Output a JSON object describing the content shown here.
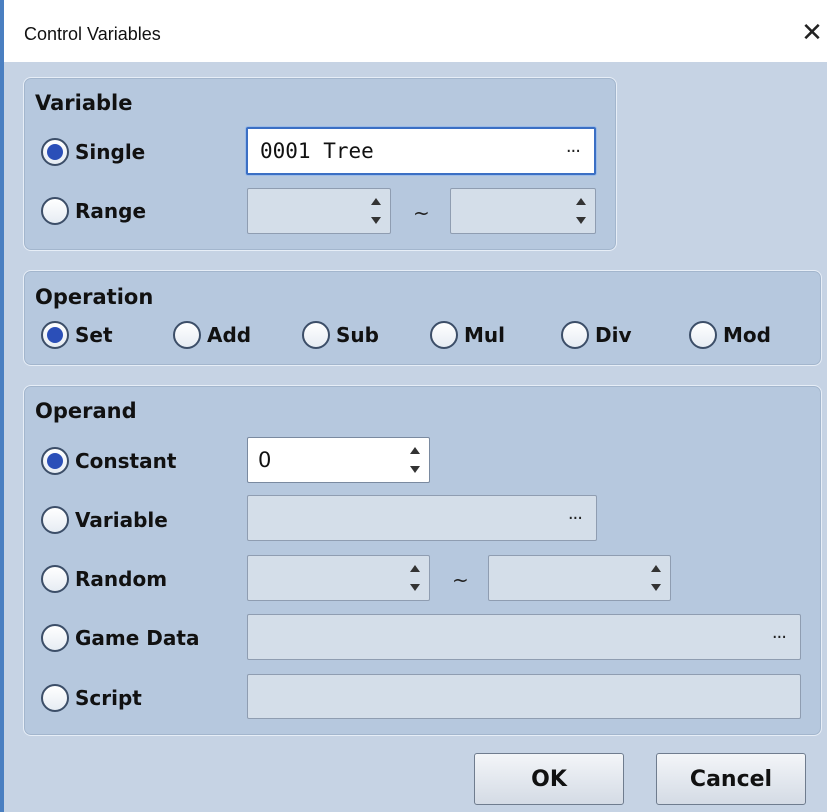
{
  "window": {
    "title": "Control Variables",
    "close_glyph": "✕"
  },
  "variable": {
    "title": "Variable",
    "single_label": "Single",
    "range_label": "Range",
    "single_value": "0001 Tree",
    "ellipsis": "···",
    "range_separator": "~",
    "range_from": "",
    "range_to": "",
    "mode": "single"
  },
  "operation": {
    "title": "Operation",
    "options": [
      "Set",
      "Add",
      "Sub",
      "Mul",
      "Div",
      "Mod"
    ],
    "selected": "Set"
  },
  "operand": {
    "title": "Operand",
    "constant_label": "Constant",
    "constant_value": "0",
    "variable_label": "Variable",
    "random_label": "Random",
    "random_separator": "~",
    "game_data_label": "Game Data",
    "script_label": "Script",
    "ellipsis": "···",
    "selected": "Constant"
  },
  "buttons": {
    "ok": "OK",
    "cancel": "Cancel"
  },
  "colors": {
    "panel_bg": "#b6c8de",
    "client_bg": "#c6d3e4",
    "radio_fill": "#2b4fb8",
    "focus_border": "#3b6fc4"
  }
}
